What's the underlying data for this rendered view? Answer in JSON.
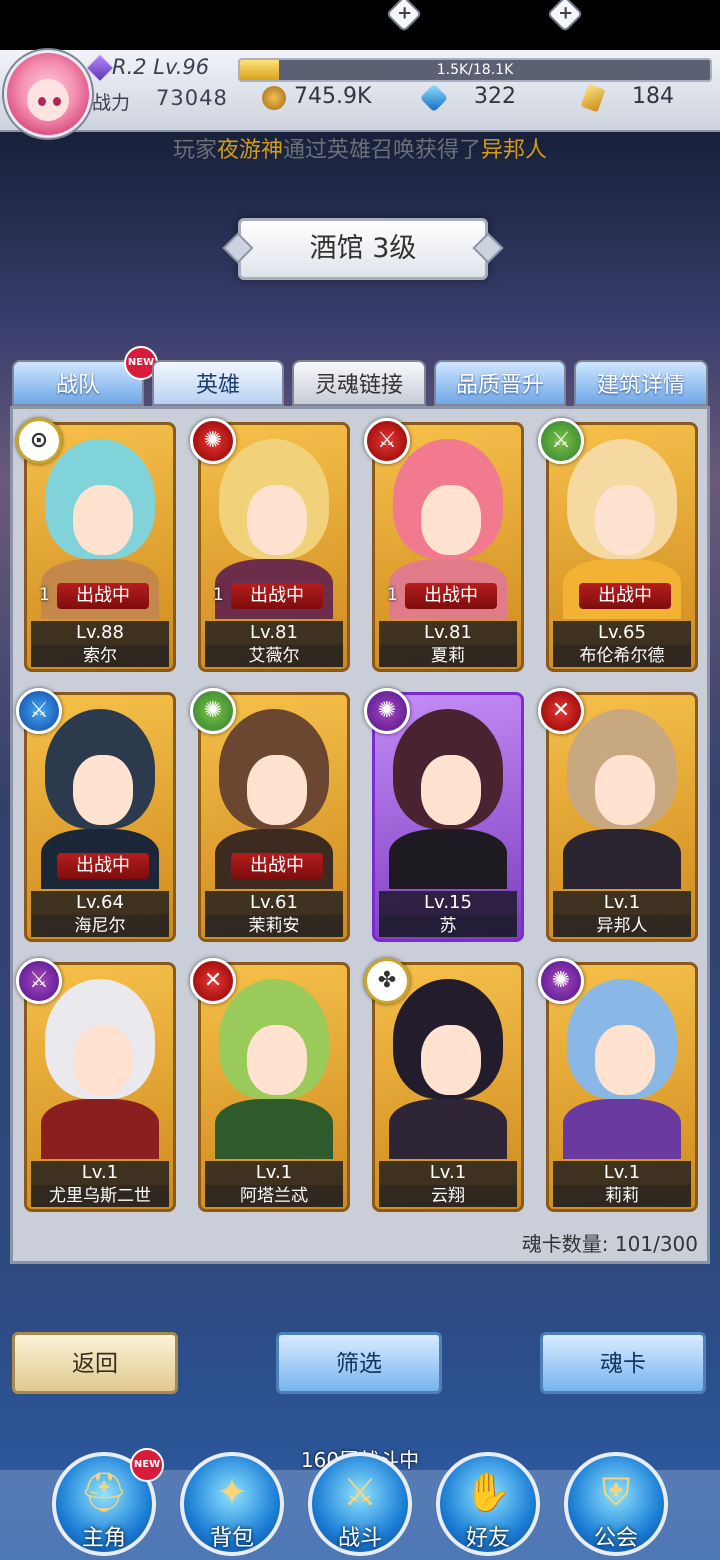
{
  "player": {
    "rank_level": "R.2 Lv.96",
    "exp_text": "1.5K/18.1K",
    "exp_fraction": 0.083,
    "power_label": "战力",
    "power_value": "73048",
    "gold": "745.9K",
    "diamonds": "322",
    "tickets": "184"
  },
  "broadcast": {
    "prefix": "玩家",
    "player_name": "夜游神",
    "middle": "通过英雄召唤获得了",
    "hero_name": "异邦人"
  },
  "building_title": "酒馆 3级",
  "tabs": [
    {
      "label": "战队"
    },
    {
      "label": "英雄"
    },
    {
      "label": "灵魂链接"
    },
    {
      "label": "品质晋升"
    },
    {
      "label": "建筑详情"
    }
  ],
  "new_badge": "NEW",
  "in_battle_label": "出战中",
  "heroes": [
    {
      "name": "索尔",
      "level": "Lv.88",
      "element": "white",
      "glyph": "⊙",
      "in_battle": true,
      "soul": "1",
      "hair": "#7fd3d9",
      "outfit": "#c4884a",
      "frame": "gold"
    },
    {
      "name": "艾薇尔",
      "level": "Lv.81",
      "element": "red",
      "glyph": "✺",
      "in_battle": true,
      "soul": "1",
      "hair": "#f1d27a",
      "outfit": "#6b2d4a",
      "frame": "gold"
    },
    {
      "name": "夏莉",
      "level": "Lv.81",
      "element": "red",
      "glyph": "⚔",
      "in_battle": true,
      "soul": "1",
      "hair": "#f27a8e",
      "outfit": "#e07c8a",
      "frame": "gold"
    },
    {
      "name": "布伦希尔德",
      "level": "Lv.65",
      "element": "green",
      "glyph": "⚔",
      "in_battle": true,
      "soul": "",
      "hair": "#f6d9a0",
      "outfit": "#f2b233",
      "frame": "gold"
    },
    {
      "name": "海尼尔",
      "level": "Lv.64",
      "element": "blue",
      "glyph": "⚔",
      "in_battle": true,
      "soul": "",
      "hair": "#2c3a4d",
      "outfit": "#1b2738",
      "frame": "gold"
    },
    {
      "name": "茉莉安",
      "level": "Lv.61",
      "element": "green",
      "glyph": "✺",
      "in_battle": true,
      "soul": "",
      "hair": "#6b4630",
      "outfit": "#3d2b22",
      "frame": "gold"
    },
    {
      "name": "苏",
      "level": "Lv.15",
      "element": "purple",
      "glyph": "✺",
      "in_battle": false,
      "soul": "",
      "hair": "#4a2330",
      "outfit": "#1d1a22",
      "frame": "purple"
    },
    {
      "name": "异邦人",
      "level": "Lv.1",
      "element": "red",
      "glyph": "✕",
      "in_battle": false,
      "soul": "",
      "hair": "#c8a880",
      "outfit": "#2a2430",
      "frame": "gold"
    },
    {
      "name": "尤里乌斯二世",
      "level": "Lv.1",
      "element": "purple",
      "glyph": "⚔",
      "in_battle": false,
      "soul": "",
      "hair": "#e9e9ee",
      "outfit": "#8b1e1e",
      "frame": "gold"
    },
    {
      "name": "阿塔兰忒",
      "level": "Lv.1",
      "element": "red",
      "glyph": "✕",
      "in_battle": false,
      "soul": "",
      "hair": "#9acb5a",
      "outfit": "#2f5a2c",
      "frame": "gold"
    },
    {
      "name": "云翔",
      "level": "Lv.1",
      "element": "white",
      "glyph": "✤",
      "in_battle": false,
      "soul": "",
      "hair": "#221c2c",
      "outfit": "#2d2436",
      "frame": "gold"
    },
    {
      "name": "莉莉",
      "level": "Lv.1",
      "element": "purple",
      "glyph": "✺",
      "in_battle": false,
      "soul": "",
      "hair": "#8ab8e6",
      "outfit": "#6a3aa0",
      "frame": "gold"
    }
  ],
  "soul_card_count": "魂卡数量: 101/300",
  "buttons": {
    "back": "返回",
    "filter": "筛选",
    "soul_card": "魂卡"
  },
  "floor_status": "160层战斗中",
  "nav": [
    {
      "label": "主角",
      "glyph": "⛑",
      "icon": "helmet-icon"
    },
    {
      "label": "背包",
      "glyph": "✦",
      "icon": "backpack-icon"
    },
    {
      "label": "战斗",
      "glyph": "⚔",
      "icon": "crossed-swords-icon"
    },
    {
      "label": "好友",
      "glyph": "✋",
      "icon": "handshake-icon"
    },
    {
      "label": "公会",
      "glyph": "⛨",
      "icon": "guild-crest-icon"
    }
  ]
}
